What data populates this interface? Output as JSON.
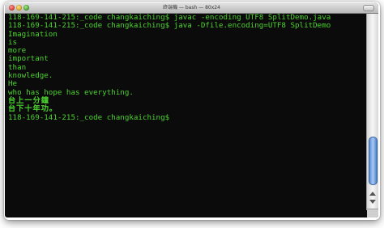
{
  "window": {
    "title": "终端機 — bash — 80x24"
  },
  "terminal": {
    "text_color": "#4bd32f",
    "background_color": "#0b0b0b",
    "lines": [
      "118-169-141-215:_code changkaiching$ javac -encoding UTF8 SplitDemo.java",
      "118-169-141-215:_code changkaiching$ java -Dfile.encoding=UTF8 SplitDemo",
      "Imagination",
      "is",
      "more",
      "important",
      "than",
      "knowledge.",
      "He",
      "who has hope has everything.",
      "台上一分鐘",
      "台下十年功。",
      "118-169-141-215:_code changkaiching$"
    ]
  },
  "icons": {
    "close": "close-button-icon",
    "minimize": "minimize-button-icon",
    "zoom": "zoom-button-icon"
  }
}
